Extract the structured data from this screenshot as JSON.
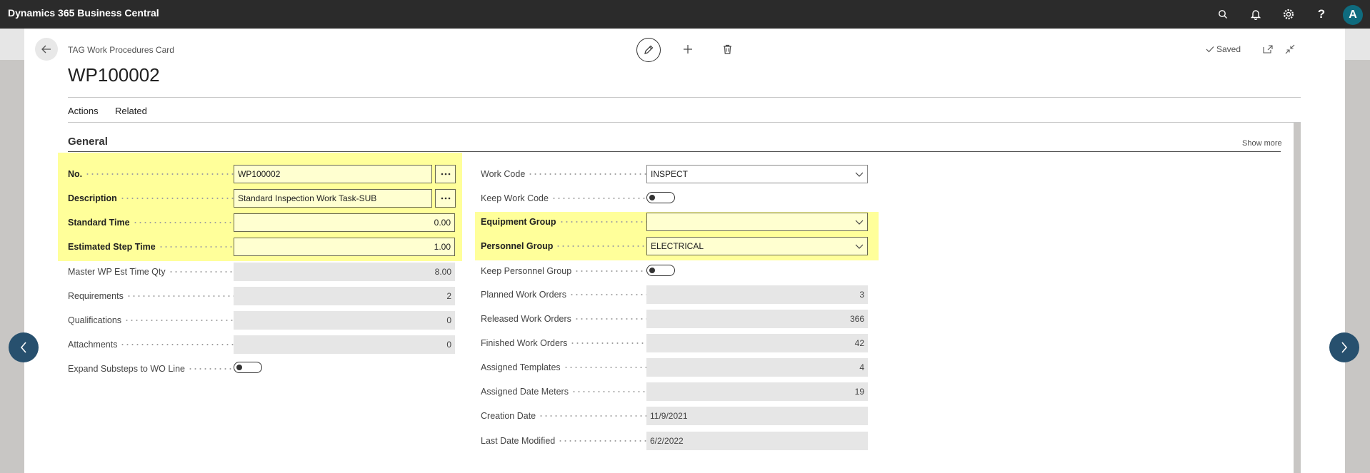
{
  "app": {
    "title": "Dynamics 365 Business Central",
    "avatar_initial": "A"
  },
  "page": {
    "caption": "TAG Work Procedures Card",
    "title": "WP100002",
    "saved_label": "Saved"
  },
  "menu": {
    "actions": "Actions",
    "related": "Related"
  },
  "section": {
    "title": "General",
    "show_more": "Show more"
  },
  "fields_left": {
    "no": {
      "label": "No.",
      "value": "WP100002"
    },
    "description": {
      "label": "Description",
      "value": "Standard Inspection Work Task-SUB"
    },
    "standard_time": {
      "label": "Standard Time",
      "value": "0.00"
    },
    "estimated_step_time": {
      "label": "Estimated Step Time",
      "value": "1.00"
    },
    "master_wp_est_time_qty": {
      "label": "Master WP Est Time Qty",
      "value": "8.00"
    },
    "requirements": {
      "label": "Requirements",
      "value": "2"
    },
    "qualifications": {
      "label": "Qualifications",
      "value": "0"
    },
    "attachments": {
      "label": "Attachments",
      "value": "0"
    },
    "expand_substeps": {
      "label": "Expand Substeps to WO Line",
      "value": false
    }
  },
  "fields_right": {
    "work_code": {
      "label": "Work Code",
      "value": "INSPECT"
    },
    "keep_work_code": {
      "label": "Keep Work Code",
      "value": false
    },
    "equipment_group": {
      "label": "Equipment Group",
      "value": ""
    },
    "personnel_group": {
      "label": "Personnel Group",
      "value": "ELECTRICAL"
    },
    "keep_personnel_group": {
      "label": "Keep Personnel Group",
      "value": false
    },
    "planned_work_orders": {
      "label": "Planned Work Orders",
      "value": "3"
    },
    "released_work_orders": {
      "label": "Released Work Orders",
      "value": "366"
    },
    "finished_work_orders": {
      "label": "Finished Work Orders",
      "value": "42"
    },
    "assigned_templates": {
      "label": "Assigned Templates",
      "value": "4"
    },
    "assigned_date_meters": {
      "label": "Assigned Date Meters",
      "value": "19"
    },
    "creation_date": {
      "label": "Creation Date",
      "value": "11/9/2021"
    },
    "last_date_modified": {
      "label": "Last Date Modified",
      "value": "6/2/2022"
    }
  },
  "icons": {
    "topbar": [
      "search-icon",
      "bell-icon",
      "gear-icon",
      "help-icon"
    ],
    "card": [
      "back-arrow-icon",
      "pencil-icon",
      "plus-icon",
      "trash-icon",
      "checkmark-icon",
      "popout-icon",
      "collapse-icon",
      "chevron-left-icon",
      "chevron-right-icon",
      "ellipsis-icon",
      "chevron-down-icon"
    ]
  },
  "colors": {
    "topbar": "#2b2b2b",
    "highlight": "#ffff9a",
    "avatar": "#0f6b7e",
    "nav_button": "#27506e",
    "readonly_field": "#e6e6e6"
  }
}
